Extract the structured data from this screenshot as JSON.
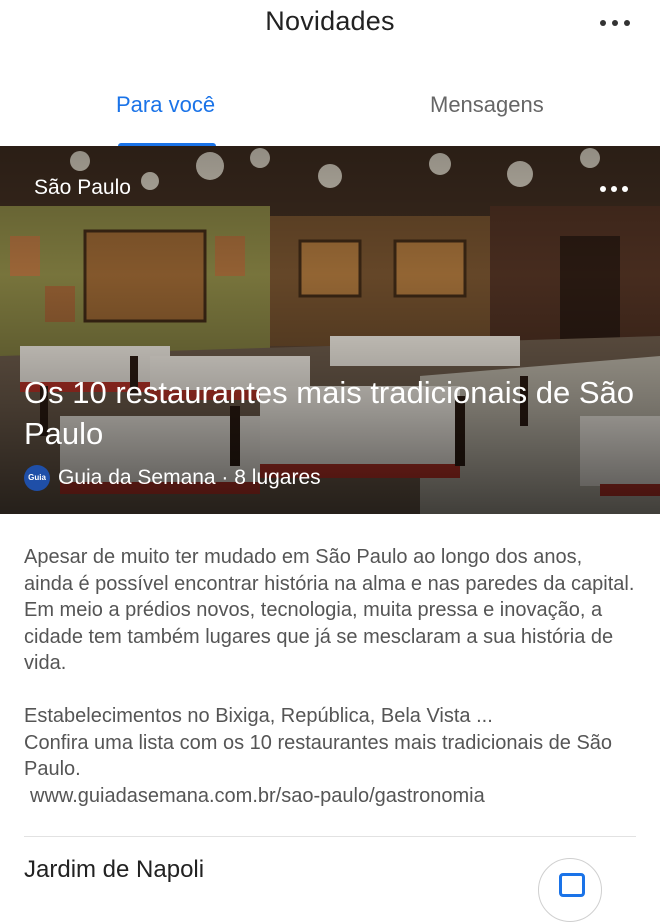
{
  "header": {
    "title": "Novidades",
    "more_icon": "more-horizontal-icon"
  },
  "tabs": [
    {
      "label": "Para você",
      "active": true
    },
    {
      "label": "Mensagens",
      "active": false
    }
  ],
  "colors": {
    "accent": "#1a73e8",
    "text_primary": "#222222",
    "text_secondary": "#555555"
  },
  "card": {
    "location": "São Paulo",
    "headline": "Os 10 restaurantes mais tradicionais de São Paulo",
    "source_logo_text": "Guia",
    "source": "Guia da Semana · 8 lugares",
    "more_icon": "more-horizontal-icon",
    "description_p1": "Apesar de muito ter mudado em São Paulo ao longo dos anos, ainda é possível encontrar história na alma e nas paredes da capital. Em meio a prédios novos, tecnologia, muita pressa e inovação, a cidade tem também lugares que já se mesclaram a sua história de vida.",
    "description_p2": "Estabelecimentos no Bixiga, República, Bela Vista ...\nConfira uma lista com os 10 restaurantes mais tradicionais de São Paulo.",
    "url": "www.guiadasemana.com.br/sao-paulo/gastronomia"
  },
  "next_item": {
    "title": "Jardim de Napoli",
    "action_icon": "save-icon"
  }
}
